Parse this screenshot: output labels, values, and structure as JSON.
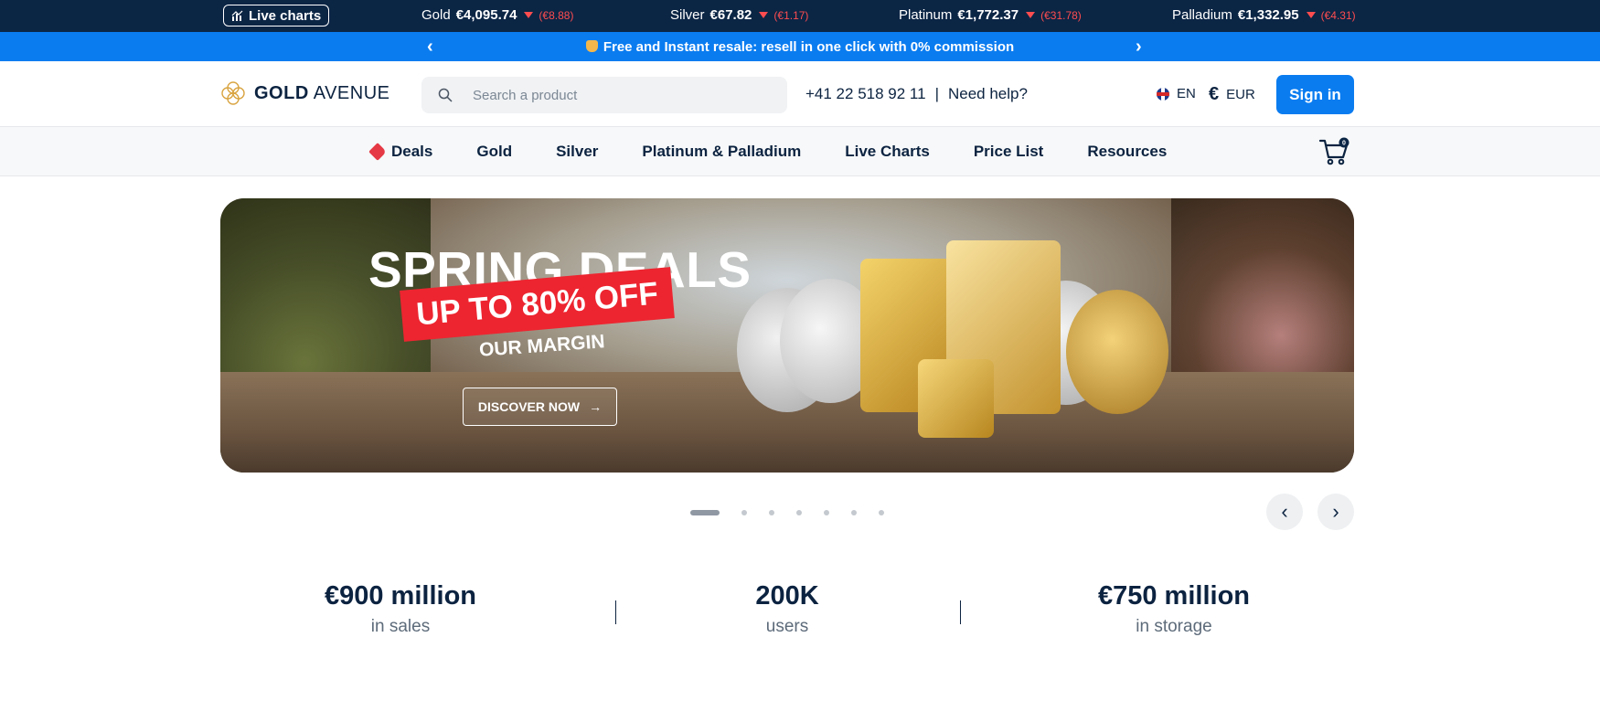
{
  "ticker": {
    "live_label": "Live charts",
    "items": [
      {
        "metal": "Gold",
        "price": "€4,095.74",
        "change": "(€8.88)"
      },
      {
        "metal": "Silver",
        "price": "€67.82",
        "change": "(€1.17)"
      },
      {
        "metal": "Platinum",
        "price": "€1,772.37",
        "change": "(€31.78)"
      },
      {
        "metal": "Palladium",
        "price": "€1,332.95",
        "change": "(€4.31)"
      }
    ]
  },
  "promo": {
    "text": "Free and Instant resale: resell in one click with 0% commission"
  },
  "header": {
    "logo_bold": "GOLD",
    "logo_light": "AVENUE",
    "search_placeholder": "Search a product",
    "phone": "+41 22 518 92 11",
    "separator": "|",
    "help": "Need help?",
    "language": "EN",
    "currency_symbol": "€",
    "currency": "EUR",
    "signin_label": "Sign in"
  },
  "nav": {
    "items": [
      "Deals",
      "Gold",
      "Silver",
      "Platinum & Palladium",
      "Live Charts",
      "Price List",
      "Resources"
    ],
    "cart_count": "0"
  },
  "hero": {
    "title": "SPRING DEALS",
    "discount": "UP TO 80% OFF",
    "subtitle": "OUR MARGIN",
    "cta_label": "DISCOVER NOW",
    "slide_count": 7,
    "active_slide": 0
  },
  "stats": [
    {
      "value": "€900 million",
      "label": "in sales"
    },
    {
      "value": "200K",
      "label": "users"
    },
    {
      "value": "€750 million",
      "label": "in storage"
    }
  ],
  "colors": {
    "navy": "#0b2545",
    "accent_blue": "#0a7cf0",
    "down_red": "#ff4d4f",
    "deal_red": "#ed2530"
  }
}
